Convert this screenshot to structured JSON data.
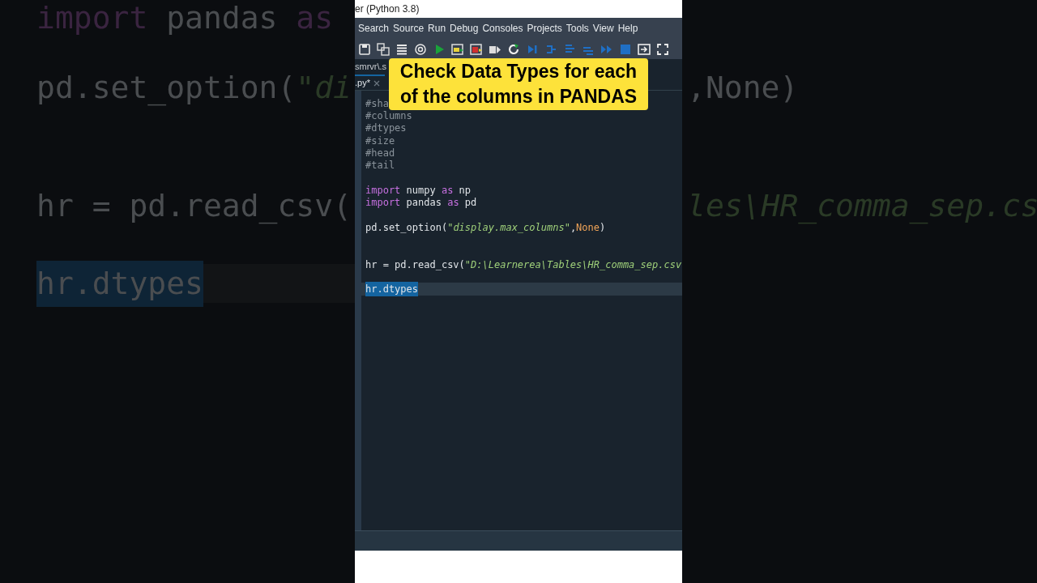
{
  "backdrop_left": {
    "lines": [
      {
        "tokens": [
          {
            "kind": "keyword",
            "text": "import"
          },
          {
            "kind": "plain",
            "text": " pandas "
          },
          {
            "kind": "keyword",
            "text": "as"
          }
        ]
      },
      {
        "tokens": [
          {
            "kind": "plain",
            "text": "pd.set_option("
          },
          {
            "kind": "string",
            "text": "\"di"
          }
        ]
      },
      {
        "tokens": [
          {
            "kind": "plain",
            "text": "hr = pd.read_csv("
          }
        ]
      },
      {
        "tokens": [
          {
            "kind": "plain",
            "text": "hr.dtypes",
            "selected": true
          }
        ],
        "current": true
      }
    ]
  },
  "backdrop_right": {
    "lines": [
      {
        "tokens": [
          {
            "kind": "plain",
            "text": ",None)"
          }
        ]
      },
      {
        "tokens": [
          {
            "kind": "string",
            "text": "les\\HR_comma_sep.cs"
          }
        ]
      }
    ]
  },
  "window": {
    "title": "er (Python 3.8)"
  },
  "menu": [
    "Search",
    "Source",
    "Run",
    "Debug",
    "Consoles",
    "Projects",
    "Tools",
    "View",
    "Help"
  ],
  "path": "smrvr\\.s",
  "tab": {
    "label": ".py*",
    "selected": true
  },
  "editor": {
    "lines": [
      {
        "tokens": [
          {
            "kind": "comment",
            "text": "#sha"
          }
        ]
      },
      {
        "tokens": [
          {
            "kind": "comment",
            "text": "#columns"
          }
        ]
      },
      {
        "tokens": [
          {
            "kind": "comment",
            "text": "#dtypes"
          }
        ]
      },
      {
        "tokens": [
          {
            "kind": "comment",
            "text": "#size"
          }
        ]
      },
      {
        "tokens": [
          {
            "kind": "comment",
            "text": "#head"
          }
        ]
      },
      {
        "tokens": [
          {
            "kind": "comment",
            "text": "#tail"
          }
        ]
      },
      {
        "blank": true
      },
      {
        "tokens": [
          {
            "kind": "keyword",
            "text": "import"
          },
          {
            "kind": "plain",
            "text": " numpy "
          },
          {
            "kind": "keyword",
            "text": "as"
          },
          {
            "kind": "plain",
            "text": " np"
          }
        ]
      },
      {
        "tokens": [
          {
            "kind": "keyword",
            "text": "import"
          },
          {
            "kind": "plain",
            "text": " pandas "
          },
          {
            "kind": "keyword",
            "text": "as"
          },
          {
            "kind": "plain",
            "text": " pd"
          }
        ]
      },
      {
        "blank": true
      },
      {
        "tokens": [
          {
            "kind": "plain",
            "text": "pd.set_option("
          },
          {
            "kind": "string",
            "text": "\"display.max_columns\""
          },
          {
            "kind": "plain",
            "text": ","
          },
          {
            "kind": "constant",
            "text": "None"
          },
          {
            "kind": "plain",
            "text": ")"
          }
        ]
      },
      {
        "blank": true
      },
      {
        "blank": true
      },
      {
        "tokens": [
          {
            "kind": "plain",
            "text": "hr = pd.read_csv("
          },
          {
            "kind": "string",
            "text": "\"D:\\Learnerea\\Tables\\HR_comma_sep.csv"
          }
        ]
      },
      {
        "blank": true
      },
      {
        "tokens": [
          {
            "kind": "plain",
            "text": "hr.dtypes",
            "selected": true
          }
        ],
        "current": true
      }
    ]
  },
  "caption": [
    "Check Data Types for each",
    "of the columns in PANDAS"
  ]
}
